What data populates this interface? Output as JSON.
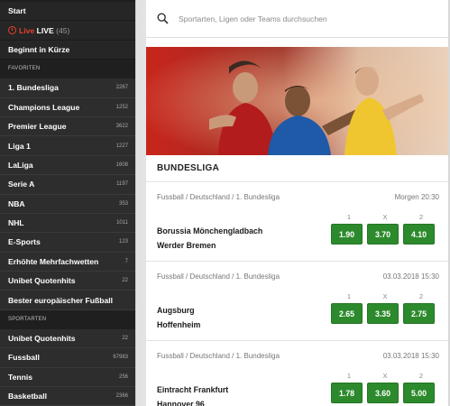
{
  "sidebar": {
    "top": [
      {
        "label": "Start"
      },
      {
        "label_live": "LIVE",
        "label_prefix": "Live",
        "count": "(45)"
      },
      {
        "label": "Beginnt in Kürze"
      }
    ],
    "favorites_header": "FAVORITEN",
    "favorites": [
      {
        "label": "1. Bundesliga",
        "count": "2267"
      },
      {
        "label": "Champions League",
        "count": "1252"
      },
      {
        "label": "Premier League",
        "count": "3622"
      },
      {
        "label": "Liga 1",
        "count": "1227"
      },
      {
        "label": "LaLiga",
        "count": "1608"
      },
      {
        "label": "Serie A",
        "count": "1197"
      },
      {
        "label": "NBA",
        "count": "353"
      },
      {
        "label": "NHL",
        "count": "1011"
      },
      {
        "label": "E-Sports",
        "count": "123"
      },
      {
        "label": "Erhöhte Mehrfachwetten",
        "count": "7"
      },
      {
        "label": "Unibet Quotenhits",
        "count": "22"
      },
      {
        "label": "Bester europäischer Fußball",
        "count": ""
      }
    ],
    "sports_header": "SPORTARTEN",
    "sports": [
      {
        "label": "Unibet Quotenhits",
        "count": "22"
      },
      {
        "label": "Fussball",
        "count": "67983"
      },
      {
        "label": "Tennis",
        "count": "256"
      },
      {
        "label": "Basketball",
        "count": "2366"
      }
    ]
  },
  "search": {
    "placeholder": "Sportarten, Ligen oder Teams durchsuchen"
  },
  "section_title": "BUNDESLIGA",
  "odds_headers": [
    "1",
    "X",
    "2"
  ],
  "matches": [
    {
      "meta": "Fussball / Deutschland / 1. Bundesliga",
      "date": "Morgen 20:30",
      "home": "Borussia Mönchengladbach",
      "away": "Werder Bremen",
      "odds": [
        "1.90",
        "3.70",
        "4.10"
      ]
    },
    {
      "meta": "Fussball / Deutschland / 1. Bundesliga",
      "date": "03.03.2018 15:30",
      "home": "Augsburg",
      "away": "Hoffenheim",
      "odds": [
        "2.65",
        "3.35",
        "2.75"
      ]
    },
    {
      "meta": "Fussball / Deutschland / 1. Bundesliga",
      "date": "03.03.2018 15:30",
      "home": "Eintracht Frankfurt",
      "away": "Hannover 96",
      "odds": [
        "1.78",
        "3.60",
        "5.00"
      ]
    }
  ],
  "colors": {
    "accent_green": "#2c8a2c",
    "live_red": "#e8412c",
    "sidebar_bg": "#2d2d2d"
  }
}
